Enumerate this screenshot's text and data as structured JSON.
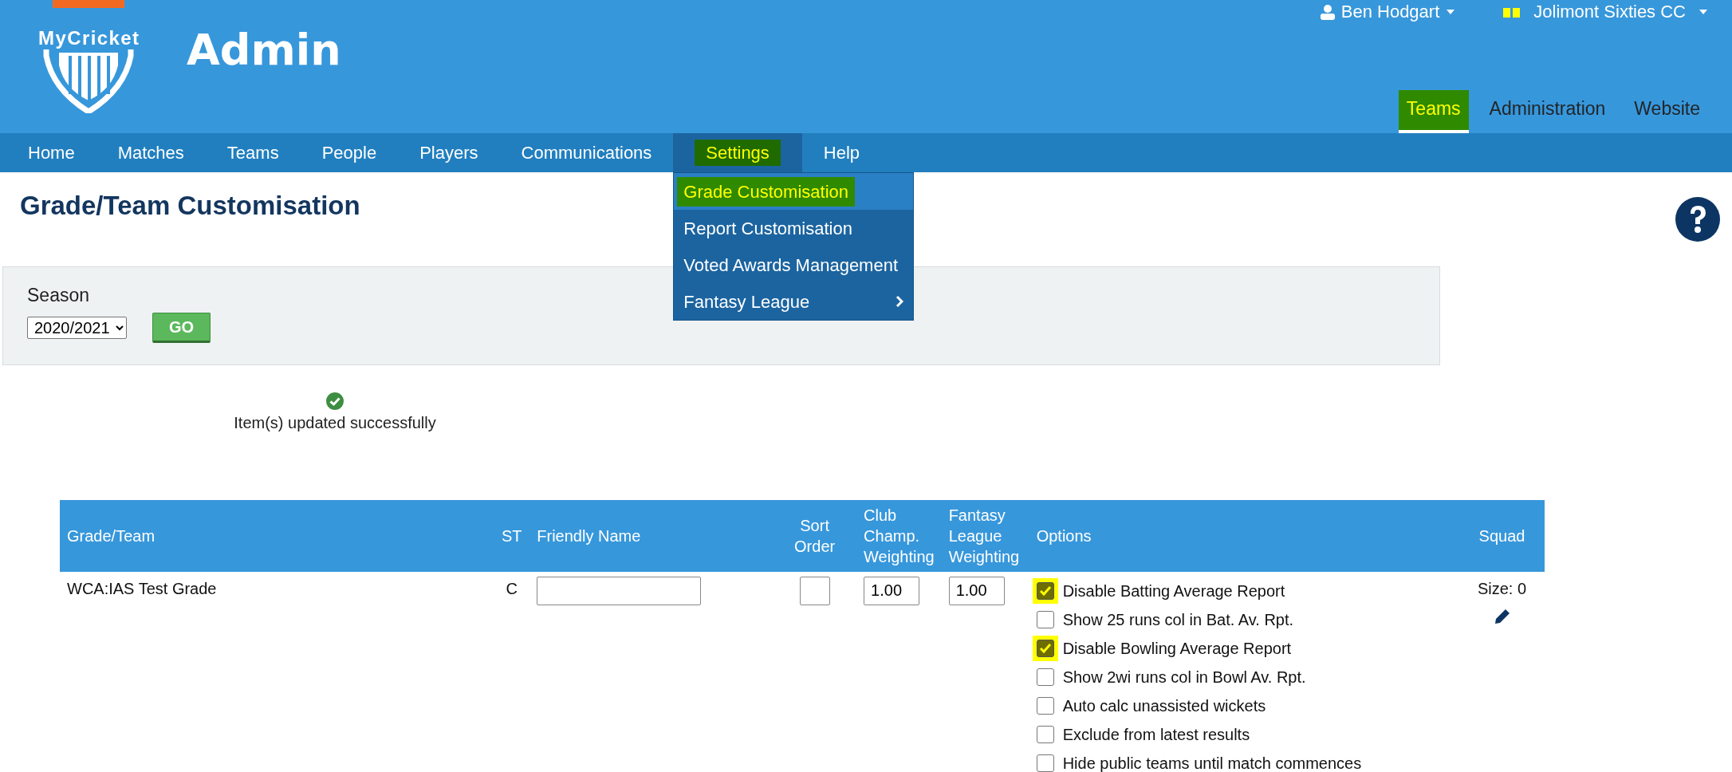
{
  "header": {
    "logo_text": "MyCricket",
    "title": "Admin",
    "user": {
      "name": "Ben Hodgart"
    },
    "club": {
      "name": "Jolimont Sixties CC"
    },
    "top_nav": [
      {
        "label": "Teams",
        "selected": true,
        "highlighted": true
      },
      {
        "label": "Administration",
        "selected": false,
        "highlighted": false
      },
      {
        "label": "Website",
        "selected": false,
        "highlighted": false
      }
    ]
  },
  "menu": [
    {
      "label": "Home",
      "selected": false,
      "highlighted": false
    },
    {
      "label": "Matches",
      "selected": false,
      "highlighted": false
    },
    {
      "label": "Teams",
      "selected": false,
      "highlighted": false
    },
    {
      "label": "People",
      "selected": false,
      "highlighted": false
    },
    {
      "label": "Players",
      "selected": false,
      "highlighted": false
    },
    {
      "label": "Communications",
      "selected": false,
      "highlighted": false
    },
    {
      "label": "Settings",
      "selected": true,
      "highlighted": true,
      "submenu": [
        {
          "label": "Grade Customisation",
          "selected": true,
          "highlighted": true,
          "has_submenu": false
        },
        {
          "label": "Report Customisation",
          "selected": false,
          "highlighted": false,
          "has_submenu": false
        },
        {
          "label": "Voted Awards Management",
          "selected": false,
          "highlighted": false,
          "has_submenu": false
        },
        {
          "label": "Fantasy League",
          "selected": false,
          "highlighted": false,
          "has_submenu": true
        }
      ]
    },
    {
      "label": "Help",
      "selected": false,
      "highlighted": false
    }
  ],
  "page_title": "Grade/Team Customisation",
  "season": {
    "label": "Season",
    "value": "2020/2021",
    "button": "GO"
  },
  "message": {
    "kind": "success",
    "text": "Item(s) updated successfully"
  },
  "table": {
    "columns": [
      "Grade/Team",
      "ST",
      "Friendly Name",
      "Sort Order",
      "Club Champ. Weighting",
      "Fantasy League Weighting",
      "Options",
      "Squad"
    ],
    "rows": [
      {
        "grade_team": "WCA:IAS Test Grade",
        "st": "C",
        "club_weighting": "1.00",
        "fantasy_weighting": "1.00",
        "options": [
          {
            "label": "Disable Batting Average Report",
            "checked": true,
            "highlighted": true
          },
          {
            "label": "Show 25 runs col in Bat. Av. Rpt.",
            "checked": false,
            "highlighted": false
          },
          {
            "label": "Disable Bowling Average Report",
            "checked": true,
            "highlighted": true
          },
          {
            "label": "Show 2wi runs col in Bowl Av. Rpt.",
            "checked": false,
            "highlighted": false
          },
          {
            "label": "Auto calc unassisted wickets",
            "checked": false,
            "highlighted": false
          },
          {
            "label": "Exclude from latest results",
            "checked": false,
            "highlighted": false
          },
          {
            "label": "Hide public teams until match commences",
            "checked": false,
            "highlighted": false
          }
        ],
        "squad_size": "Size: 0"
      }
    ]
  }
}
